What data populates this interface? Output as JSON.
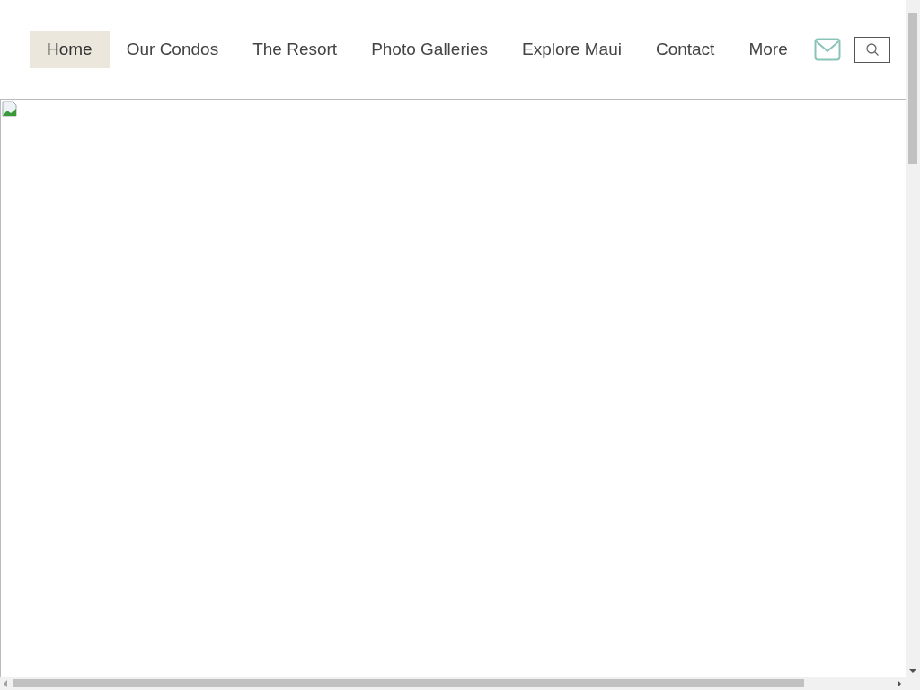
{
  "nav": {
    "items": [
      {
        "label": "Home",
        "selected": true
      },
      {
        "label": "Our Condos",
        "selected": false
      },
      {
        "label": "The Resort",
        "selected": false
      },
      {
        "label": "Photo Galleries",
        "selected": false
      },
      {
        "label": "Explore Maui",
        "selected": false
      },
      {
        "label": "Contact",
        "selected": false
      },
      {
        "label": "More",
        "selected": false
      }
    ]
  }
}
